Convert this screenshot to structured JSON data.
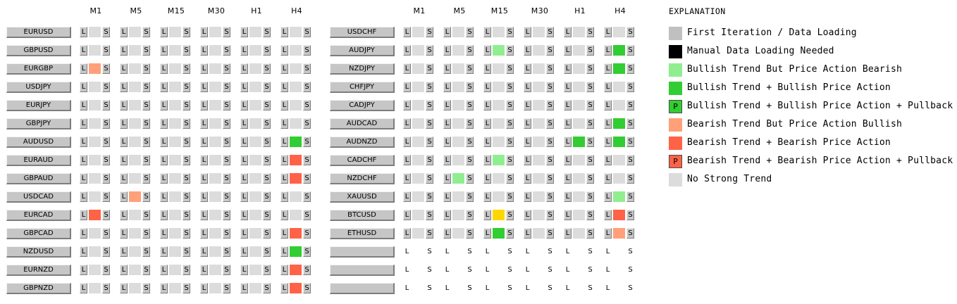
{
  "timeframes": [
    "M1",
    "M5",
    "M15",
    "M30",
    "H1",
    "H4"
  ],
  "long_label": "L",
  "short_label": "S",
  "colors": {
    "loading": "#c0c0c0",
    "manual": "#000000",
    "bull_pa_bear": "#90ee90",
    "bull": "#32cd32",
    "bear_pa_bull": "#ffa07a",
    "bear": "#ff6347",
    "none": "#dcdcdc",
    "warn": "#ffd700"
  },
  "left_panel": {
    "rows": [
      {
        "symbol": "EURUSD",
        "states": [
          "none",
          "none",
          "none",
          "none",
          "none",
          "none"
        ]
      },
      {
        "symbol": "GBPUSD",
        "states": [
          "none",
          "none",
          "none",
          "none",
          "none",
          "none"
        ]
      },
      {
        "symbol": "EURGBP",
        "states": [
          "bear_pa_bull",
          "none",
          "none",
          "none",
          "none",
          "none"
        ]
      },
      {
        "symbol": "USDJPY",
        "states": [
          "none",
          "none",
          "none",
          "none",
          "none",
          "none"
        ]
      },
      {
        "symbol": "EURJPY",
        "states": [
          "none",
          "none",
          "none",
          "none",
          "none",
          "none"
        ]
      },
      {
        "symbol": "GBPJPY",
        "states": [
          "none",
          "none",
          "none",
          "none",
          "none",
          "none"
        ]
      },
      {
        "symbol": "AUDUSD",
        "states": [
          "none",
          "none",
          "none",
          "none",
          "none",
          "bull"
        ]
      },
      {
        "symbol": "EURAUD",
        "states": [
          "none",
          "none",
          "none",
          "none",
          "none",
          "bear"
        ]
      },
      {
        "symbol": "GBPAUD",
        "states": [
          "none",
          "none",
          "none",
          "none",
          "none",
          "bear"
        ]
      },
      {
        "symbol": "USDCAD",
        "states": [
          "none",
          "bear_pa_bull",
          "none",
          "none",
          "none",
          "none"
        ]
      },
      {
        "symbol": "EURCAD",
        "states": [
          "bear",
          "none",
          "none",
          "none",
          "none",
          "none"
        ]
      },
      {
        "symbol": "GBPCAD",
        "states": [
          "none",
          "none",
          "none",
          "none",
          "none",
          "bear"
        ]
      },
      {
        "symbol": "NZDUSD",
        "states": [
          "none",
          "none",
          "none",
          "none",
          "none",
          "bull"
        ]
      },
      {
        "symbol": "EURNZD",
        "states": [
          "none",
          "none",
          "none",
          "none",
          "none",
          "bear"
        ]
      },
      {
        "symbol": "GBPNZD",
        "states": [
          "none",
          "none",
          "none",
          "none",
          "none",
          "bear"
        ]
      }
    ]
  },
  "right_panel": {
    "rows": [
      {
        "symbol": "USDCHF",
        "states": [
          "none",
          "none",
          "none",
          "none",
          "none",
          "none"
        ]
      },
      {
        "symbol": "AUDJPY",
        "states": [
          "none",
          "none",
          "bull_pa_bear",
          "none",
          "none",
          "bull"
        ]
      },
      {
        "symbol": "NZDJPY",
        "states": [
          "none",
          "none",
          "none",
          "none",
          "none",
          "bull"
        ]
      },
      {
        "symbol": "CHFJPY",
        "states": [
          "none",
          "none",
          "none",
          "none",
          "none",
          "none"
        ]
      },
      {
        "symbol": "CADJPY",
        "states": [
          "none",
          "none",
          "none",
          "none",
          "none",
          "none"
        ]
      },
      {
        "symbol": "AUDCAD",
        "states": [
          "none",
          "none",
          "none",
          "none",
          "none",
          "bull"
        ]
      },
      {
        "symbol": "AUDNZD",
        "states": [
          "none",
          "none",
          "none",
          "none",
          "bull",
          "bull"
        ]
      },
      {
        "symbol": "CADCHF",
        "states": [
          "none",
          "none",
          "bull_pa_bear",
          "none",
          "none",
          "none"
        ]
      },
      {
        "symbol": "NZDCHF",
        "states": [
          "none",
          "bull_pa_bear",
          "none",
          "none",
          "none",
          "none"
        ]
      },
      {
        "symbol": "XAUUSD",
        "states": [
          "none",
          "none",
          "none",
          "none",
          "none",
          "bull_pa_bear"
        ]
      },
      {
        "symbol": "BTCUSD",
        "states": [
          "none",
          "none",
          "warn",
          "none",
          "none",
          "bear"
        ]
      },
      {
        "symbol": "ETHUSD",
        "states": [
          "none",
          "none",
          "bull",
          "none",
          "none",
          "bear_pa_bull"
        ]
      },
      {
        "symbol": "",
        "states": [
          "",
          "",
          "",
          "",
          "",
          ""
        ]
      },
      {
        "symbol": "",
        "states": [
          "",
          "",
          "",
          "",
          "",
          ""
        ]
      },
      {
        "symbol": "",
        "states": [
          "",
          "",
          "",
          "",
          "",
          ""
        ]
      }
    ]
  },
  "legend": {
    "title": "EXPLANATION",
    "items": [
      {
        "name": "legend-loading",
        "color": "#c0c0c0",
        "mark": "",
        "border": false,
        "label": "First Iteration / Data Loading"
      },
      {
        "name": "legend-manual",
        "color": "#000000",
        "mark": "",
        "border": false,
        "label": "Manual Data Loading Needed"
      },
      {
        "name": "legend-bull-pa-bear",
        "color": "#90ee90",
        "mark": "",
        "border": false,
        "label": "Bullish Trend But Price Action Bearish"
      },
      {
        "name": "legend-bull",
        "color": "#32cd32",
        "mark": "",
        "border": false,
        "label": "Bullish Trend + Bullish Price Action"
      },
      {
        "name": "legend-bull-pullback",
        "color": "#32cd32",
        "mark": "P",
        "border": true,
        "label": "Bullish Trend + Bullish Price Action + Pullback"
      },
      {
        "name": "legend-bear-pa-bull",
        "color": "#ffa07a",
        "mark": "",
        "border": false,
        "label": "Bearish Trend But Price Action Bullish"
      },
      {
        "name": "legend-bear",
        "color": "#ff6347",
        "mark": "",
        "border": false,
        "label": "Bearish Trend + Bearish Price Action"
      },
      {
        "name": "legend-bear-pullback",
        "color": "#ff6347",
        "mark": "P",
        "border": true,
        "label": "Bearish Trend + Bearish Price Action + Pullback"
      },
      {
        "name": "legend-none",
        "color": "#dcdcdc",
        "mark": "",
        "border": false,
        "label": "No Strong Trend"
      }
    ]
  }
}
